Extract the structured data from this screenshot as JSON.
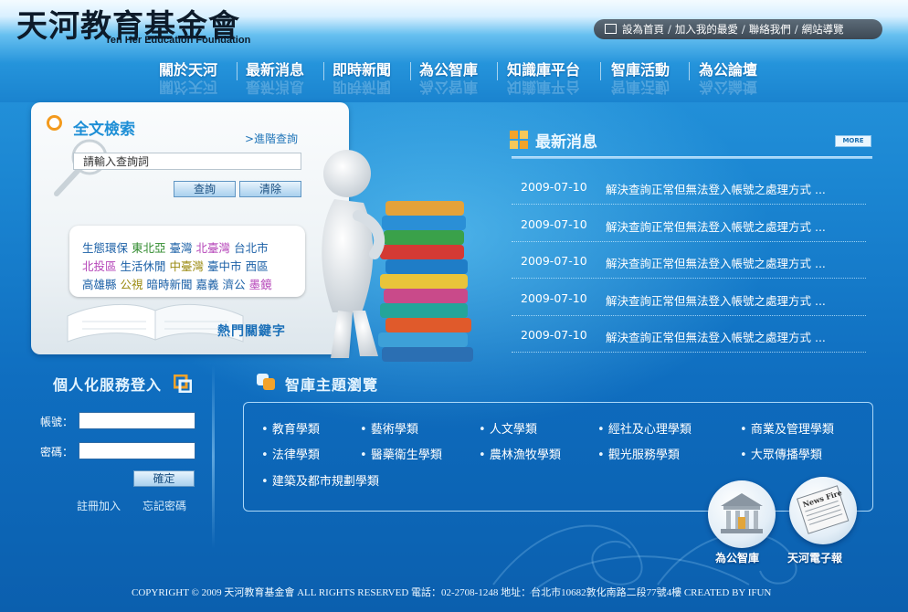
{
  "header": {
    "logo_text": "天河教育基金會",
    "logo_text_en": "Ten Her Education Foundation",
    "top_links": [
      "設為首頁",
      "加入我的最愛",
      "聯絡我們",
      "網站導覽"
    ],
    "top_link_separator": "/",
    "nav": [
      "關於天河",
      "最新消息",
      "即時新聞",
      "為公智庫",
      "知識庫平台",
      "智庫活動",
      "為公論壇"
    ]
  },
  "search": {
    "title": "全文檢索",
    "advanced_link": ">進階查詢",
    "input_value": "請輸入查詢詞",
    "search_button": "查詢",
    "clear_button": "清除",
    "hot_keywords_label": "熱門關鍵字",
    "keywords": [
      {
        "text": "生態環保",
        "color": "#1a5fa6"
      },
      {
        "text": "東北亞",
        "color": "#2f8a2c"
      },
      {
        "text": "臺灣",
        "color": "#1a5fa6"
      },
      {
        "text": "北臺灣",
        "color": "#b544b8"
      },
      {
        "text": "台北市",
        "color": "#1a5fa6"
      },
      {
        "text": "北投區",
        "color": "#b544b8"
      },
      {
        "text": "生活休閒",
        "color": "#1a5fa6"
      },
      {
        "text": "中臺灣",
        "color": "#9a8a10"
      },
      {
        "text": "臺中市",
        "color": "#1a5fa6"
      },
      {
        "text": "西區",
        "color": "#1a5fa6"
      },
      {
        "text": "高雄縣",
        "color": "#1a5fa6"
      },
      {
        "text": "公視",
        "color": "#9a8a10"
      },
      {
        "text": "暗時新聞",
        "color": "#1a5fa6"
      },
      {
        "text": "嘉義",
        "color": "#1a5fa6"
      },
      {
        "text": "濟公",
        "color": "#1a5fa6"
      },
      {
        "text": "墨鏡",
        "color": "#b544b8"
      }
    ]
  },
  "news": {
    "title": "最新消息",
    "more_label": "MORE",
    "items": [
      {
        "date": "2009-07-10",
        "title": "解決查詢正常但無法登入帳號之處理方式 ..."
      },
      {
        "date": "2009-07-10",
        "title": "解決查詢正常但無法登入帳號之處理方式 ..."
      },
      {
        "date": "2009-07-10",
        "title": "解決查詢正常但無法登入帳號之處理方式 ..."
      },
      {
        "date": "2009-07-10",
        "title": "解決查詢正常但無法登入帳號之處理方式 ..."
      },
      {
        "date": "2009-07-10",
        "title": "解決查詢正常但無法登入帳號之處理方式 ..."
      }
    ]
  },
  "login": {
    "title": "個人化服務登入",
    "account_label": "帳號：",
    "password_label": "密碼：",
    "confirm_button": "確定",
    "register_link": "註冊加入",
    "forgot_link": "忘記密碼"
  },
  "topics": {
    "title": "智庫主題瀏覽",
    "items": [
      "教育學類",
      "藝術學類",
      "人文學類",
      "經社及心理學類",
      "商業及管理學類",
      "法律學類",
      "醫藥衛生學類",
      "農林漁牧學類",
      "觀光服務學類",
      "大眾傳播學類",
      "建築及都市規劃學類"
    ]
  },
  "quick_links": {
    "think_tank_label": "為公智庫",
    "enews_label": "天河電子報",
    "newspaper_text": "News Fire"
  },
  "footer": {
    "text": "COPYRIGHT © 2009 天河教育基金會 ALL RIGHTS RESERVED 電話：02-2708-1248  地址：台北市10682敦化南路二段77號4樓 CREATED BY IFUN"
  },
  "colors": {
    "accent": "#1e8fd6",
    "orange": "#f39a1d"
  }
}
